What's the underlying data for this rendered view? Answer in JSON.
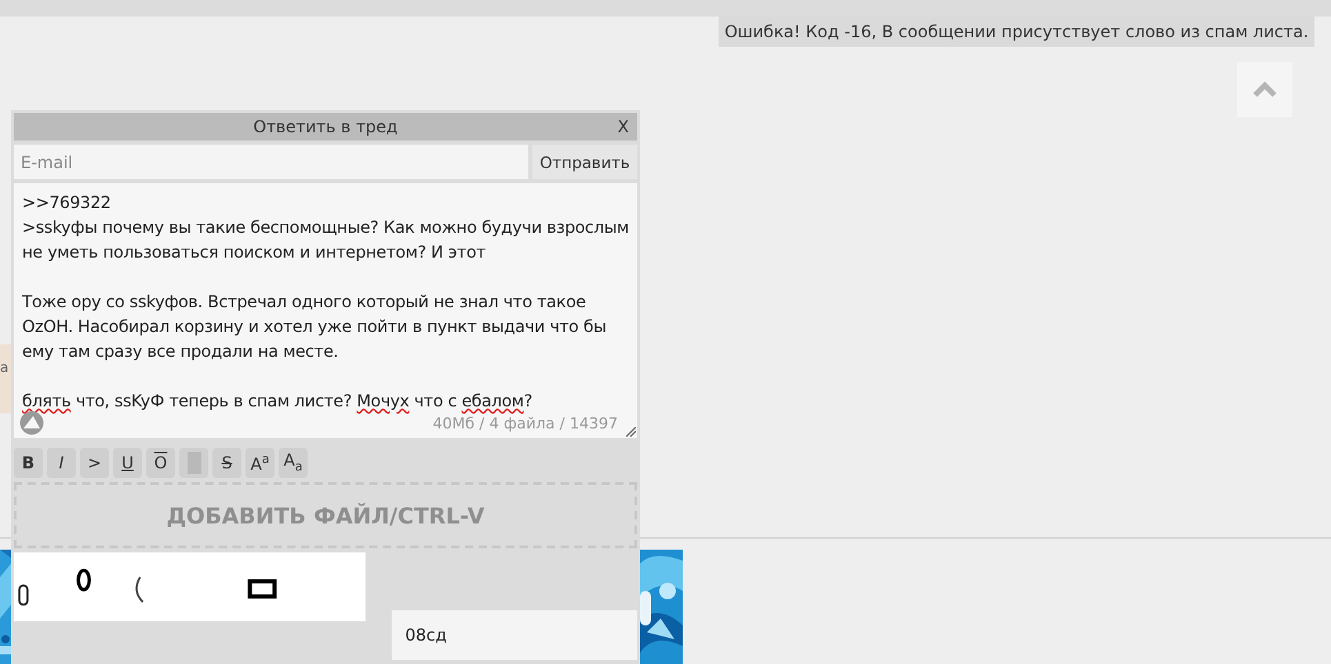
{
  "error_message": "Ошибка! Код -16, В сообщении присутствует слово из спам листа.",
  "behind_post": {
    "text_fragment": "а"
  },
  "reply_form": {
    "title": "Ответить в тред",
    "close": "X",
    "email": {
      "placeholder": "E-mail"
    },
    "send_button": "Отправить",
    "message": [
      {
        "kind": "text",
        "segments": [
          {
            "text": ">>769322",
            "misspelled": false
          }
        ]
      },
      {
        "kind": "text",
        "segments": [
          {
            "text": ">sskyфы почему вы такие беспомощные? Как можно будучи взрослым",
            "misspelled": false
          }
        ]
      },
      {
        "kind": "text",
        "segments": [
          {
            "text": "не уметь пользоваться поиском и интернетом? И этот",
            "misspelled": false
          }
        ]
      },
      {
        "kind": "blank"
      },
      {
        "kind": "text",
        "segments": [
          {
            "text": "Тоже ору со sskyфов. Встречал одного который не знал что такое",
            "misspelled": false
          }
        ]
      },
      {
        "kind": "text",
        "segments": [
          {
            "text": "OzOH. Насобирал корзину и хотел уже пойти в пункт выдачи что бы",
            "misspelled": false
          }
        ]
      },
      {
        "kind": "text",
        "segments": [
          {
            "text": "ему там сразу все продали на месте.",
            "misspelled": false
          }
        ]
      },
      {
        "kind": "blank"
      },
      {
        "kind": "text",
        "segments": [
          {
            "text": "блять",
            "misspelled": true
          },
          {
            "text": " что, ssKyФ теперь в спам листе? ",
            "misspelled": false
          },
          {
            "text": "Мочух",
            "misspelled": true
          },
          {
            "text": " что с ",
            "misspelled": false
          },
          {
            "text": "ебалом",
            "misspelled": true
          },
          {
            "text": "?",
            "misspelled": false
          }
        ]
      }
    ],
    "limits": "40Мб / 4 файла / 14397",
    "toolbar": [
      {
        "kind": "bold",
        "label": "B"
      },
      {
        "kind": "italic",
        "label": "I"
      },
      {
        "kind": "quote",
        "label": ">"
      },
      {
        "kind": "underline",
        "label": "U"
      },
      {
        "kind": "overline",
        "label": "O"
      },
      {
        "kind": "spoiler"
      },
      {
        "kind": "strike",
        "label": "S"
      },
      {
        "kind": "sup",
        "label": "A$^{a}$"
      },
      {
        "kind": "sub",
        "label": "A$_{a}$"
      }
    ],
    "dropzone": "ДОБАВИТЬ ФАЙЛ/CTRL-V",
    "captcha": {
      "value": "08сд"
    }
  }
}
